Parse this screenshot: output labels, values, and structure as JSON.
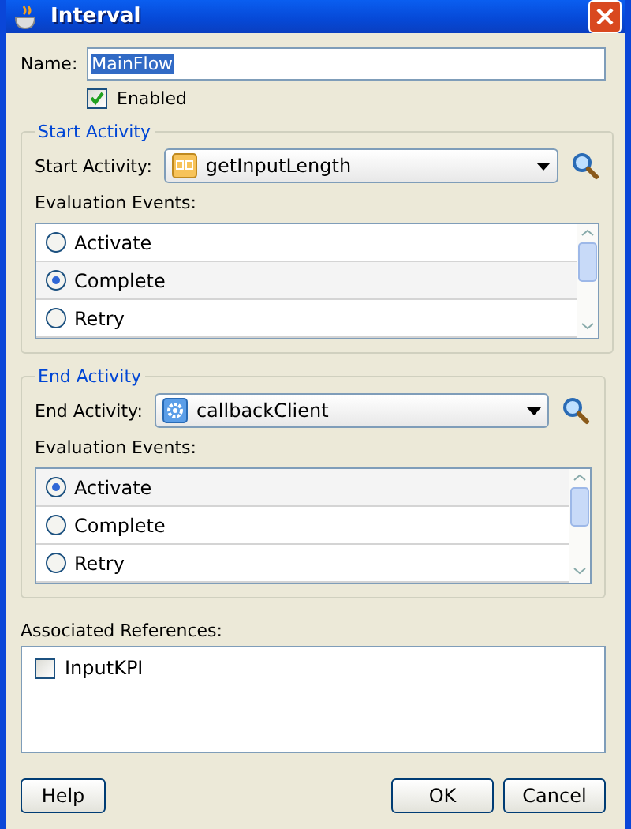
{
  "window": {
    "title": "Interval"
  },
  "name_field": {
    "label": "Name:",
    "value": "MainFlow"
  },
  "enabled": {
    "label": "Enabled",
    "checked": true
  },
  "sections": [
    {
      "legend": "Start Activity",
      "select_label": "Start Activity:",
      "value": "getInputLength",
      "kind": "flow",
      "events_label": "Evaluation Events:",
      "events": [
        {
          "label": "Activate",
          "selected": false
        },
        {
          "label": "Complete",
          "selected": true
        },
        {
          "label": "Retry",
          "selected": false
        }
      ]
    },
    {
      "legend": "End Activity",
      "select_label": "End Activity:",
      "value": "callbackClient",
      "kind": "service",
      "events_label": "Evaluation Events:",
      "events": [
        {
          "label": "Activate",
          "selected": true
        },
        {
          "label": "Complete",
          "selected": false
        },
        {
          "label": "Retry",
          "selected": false
        }
      ]
    }
  ],
  "references": {
    "label": "Associated References:",
    "items": [
      {
        "label": "InputKPI",
        "checked": false
      }
    ]
  },
  "buttons": {
    "left": [
      "Help"
    ],
    "right": [
      "OK",
      "Cancel"
    ]
  }
}
